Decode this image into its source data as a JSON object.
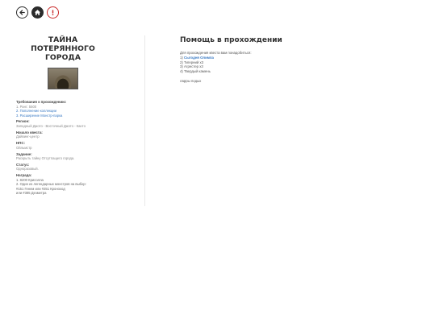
{
  "nav": {
    "back_icon": "arrow-left-icon",
    "home_icon": "home-icon",
    "alert_icon": "exclamation-icon",
    "alert_color": "#c92a2a"
  },
  "quest": {
    "title": "ТАЙНА ПОТЕРЯННОГО ГОРОДА",
    "requirements_label": "Требования к прохождению:",
    "requirements": [
      {
        "text": "1. Ранг: 5500",
        "link": false
      },
      {
        "text": "2. Пополнение коллекции",
        "link": true
      },
      {
        "text": "3. Расширение Монстр-парка",
        "link": true
      }
    ],
    "region_label": "Регион:",
    "region": "Западный Джото - Восточный Джото - Канто",
    "start_label": "Начало квеста:",
    "start": "Дайвинг-центр",
    "npc_label": "НПС:",
    "npc": "Ойльмстр",
    "task_label": "Задание:",
    "task": "Раскрыть тайну Отсутпащего города.",
    "status_label": "Статус:",
    "status": "Одноразовый.",
    "reward_label": "Награда:",
    "rewards": [
      "1. 8200 Крисолла",
      "2. Один из легендарных монстров на выбор:",
      "#151 Генем или #251 Кроноход",
      "или #385 Дезметра"
    ]
  },
  "help": {
    "title": "Помощь в прохождении",
    "intro": "Для прохождения квеста вам понадобиться:",
    "items": [
      {
        "prefix": "1) ",
        "text": "Сыгодня Олимпа",
        "link": true
      },
      {
        "prefix": "",
        "text": "2) Тигерний х3",
        "link": false
      },
      {
        "prefix": "",
        "text": "3) Агрестер х3",
        "link": false
      },
      {
        "prefix": "",
        "text": "4) Твердый камень",
        "link": false
      }
    ],
    "extra": "ларры подых"
  }
}
